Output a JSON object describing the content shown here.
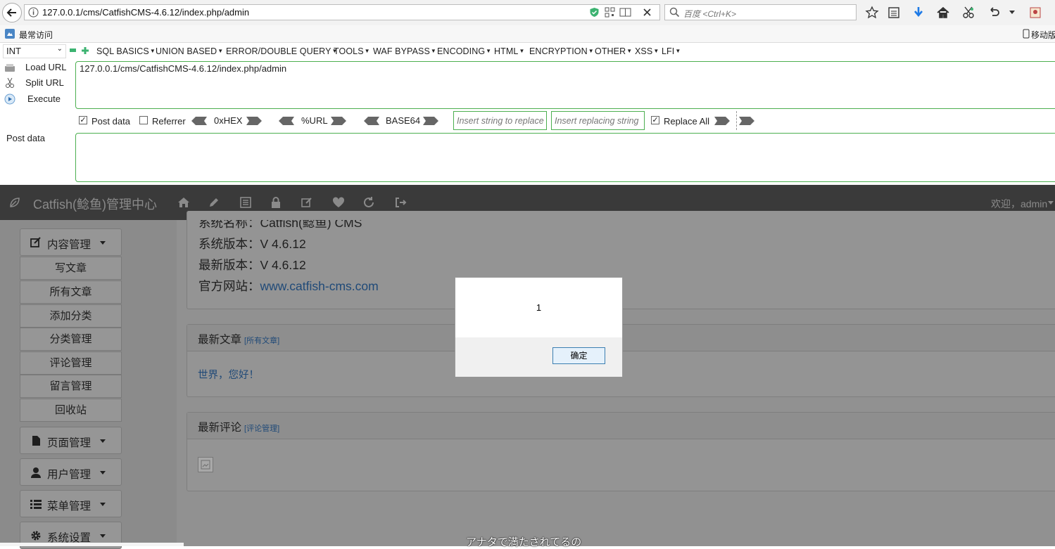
{
  "browser": {
    "url": "127.0.0.1/cms/CatfishCMS-4.6.12/index.php/admin",
    "search_placeholder": "百度 <Ctrl+K>",
    "bookmarks_label": "最常访问",
    "mobile_bookmarks_label": "移动版"
  },
  "hackbar": {
    "type_select": "INT",
    "menus": [
      "SQL BASICS",
      "UNION BASED",
      "ERROR/DOUBLE QUERY",
      "TOOLS",
      "WAF BYPASS",
      "ENCODING",
      "HTML",
      "ENCRYPTION",
      "OTHER",
      "XSS",
      "LFI"
    ],
    "load_url": "Load URL",
    "split_url": "Split URL",
    "execute": "Execute",
    "url_value": "127.0.0.1/cms/CatfishCMS-4.6.12/index.php/admin",
    "post_data_checkbox": "Post data",
    "post_data_checked": true,
    "referrer_checkbox": "Referrer",
    "referrer_checked": false,
    "hex_label": "0xHEX",
    "url_label": "%URL",
    "base64_label": "BASE64",
    "replace_from_placeholder": "Insert string to replace",
    "replace_to_placeholder": "Insert replacing string",
    "replace_all_label": "Replace All",
    "replace_all_checked": true,
    "post_data_label": "Post data"
  },
  "cms": {
    "brand": "Catfish(鲶鱼)管理中心",
    "welcome": "欢迎，admin",
    "sidebar": {
      "content_mgmt": "内容管理",
      "items": [
        "写文章",
        "所有文章",
        "添加分类",
        "分类管理",
        "评论管理",
        "留言管理",
        "回收站"
      ],
      "page_mgmt": "页面管理",
      "user_mgmt": "用户管理",
      "menu_mgmt": "菜单管理",
      "system_settings": "系统设置"
    },
    "sysinfo": {
      "name_line": "系统名称：Catfish(鲶鱼) CMS",
      "version_line": "系统版本：V 4.6.12",
      "latest_line": "最新版本：V 4.6.12",
      "site_prefix": "官方网站：",
      "site_link": "www.catfish-cms.com"
    },
    "latest_articles": {
      "title": "最新文章",
      "link": "[所有文章]",
      "item": "世界，您好！"
    },
    "latest_comments": {
      "title": "最新评论",
      "link": "[评论管理]"
    }
  },
  "alert": {
    "message": "1",
    "ok": "确定"
  },
  "subtitle": "アナタで満たされてるの"
}
